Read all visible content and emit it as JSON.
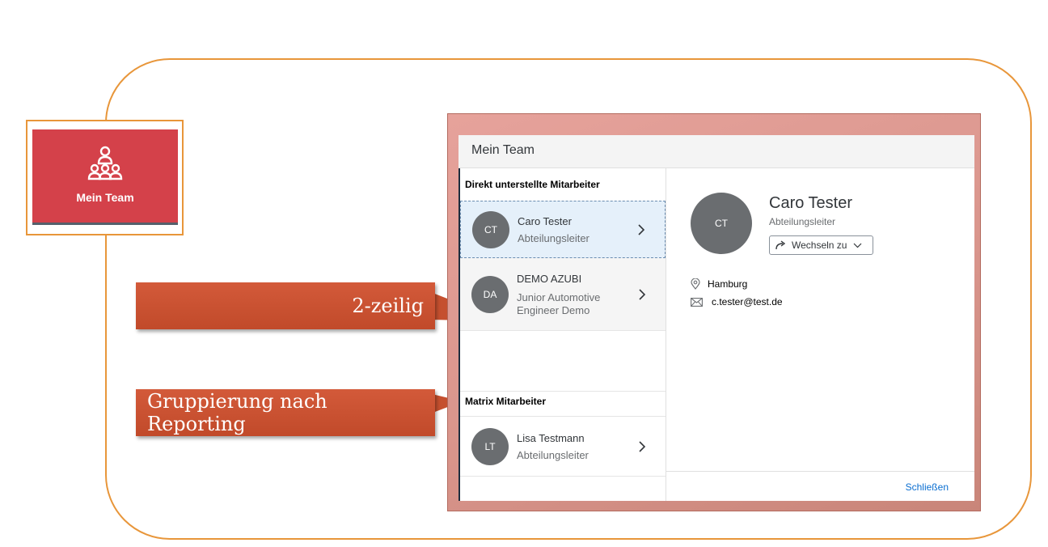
{
  "tile": {
    "label": "Mein Team",
    "icon": "team-icon",
    "color": "#d4414a"
  },
  "callouts": [
    {
      "text": "2-zeilig"
    },
    {
      "text": "Gruppierung nach Reporting"
    }
  ],
  "dialog": {
    "title": "Mein Team",
    "groups": [
      {
        "header": "Direkt unterstellte Mitarbeiter",
        "items": [
          {
            "initials": "CT",
            "name": "Caro Tester",
            "role": "Abteilungsleiter",
            "selected": true
          },
          {
            "initials": "DA",
            "name": "DEMO AZUBI",
            "role_line1": "Junior Automotive",
            "role_line2": "Engineer Demo"
          }
        ]
      },
      {
        "header": "Matrix Mitarbeiter",
        "items": [
          {
            "initials": "LT",
            "name": "Lisa Testmann",
            "role": "Abteilungsleiter"
          }
        ]
      }
    ],
    "detail": {
      "initials": "CT",
      "name": "Caro Tester",
      "role": "Abteilungsleiter",
      "switch_label": "Wechseln zu",
      "location": "Hamburg",
      "email": "c.tester@test.de"
    },
    "close_label": "Schließen"
  },
  "colors": {
    "accent_orange": "#e8963a",
    "link_blue": "#0a6ed1",
    "avatar_gray": "#6a6d70"
  }
}
